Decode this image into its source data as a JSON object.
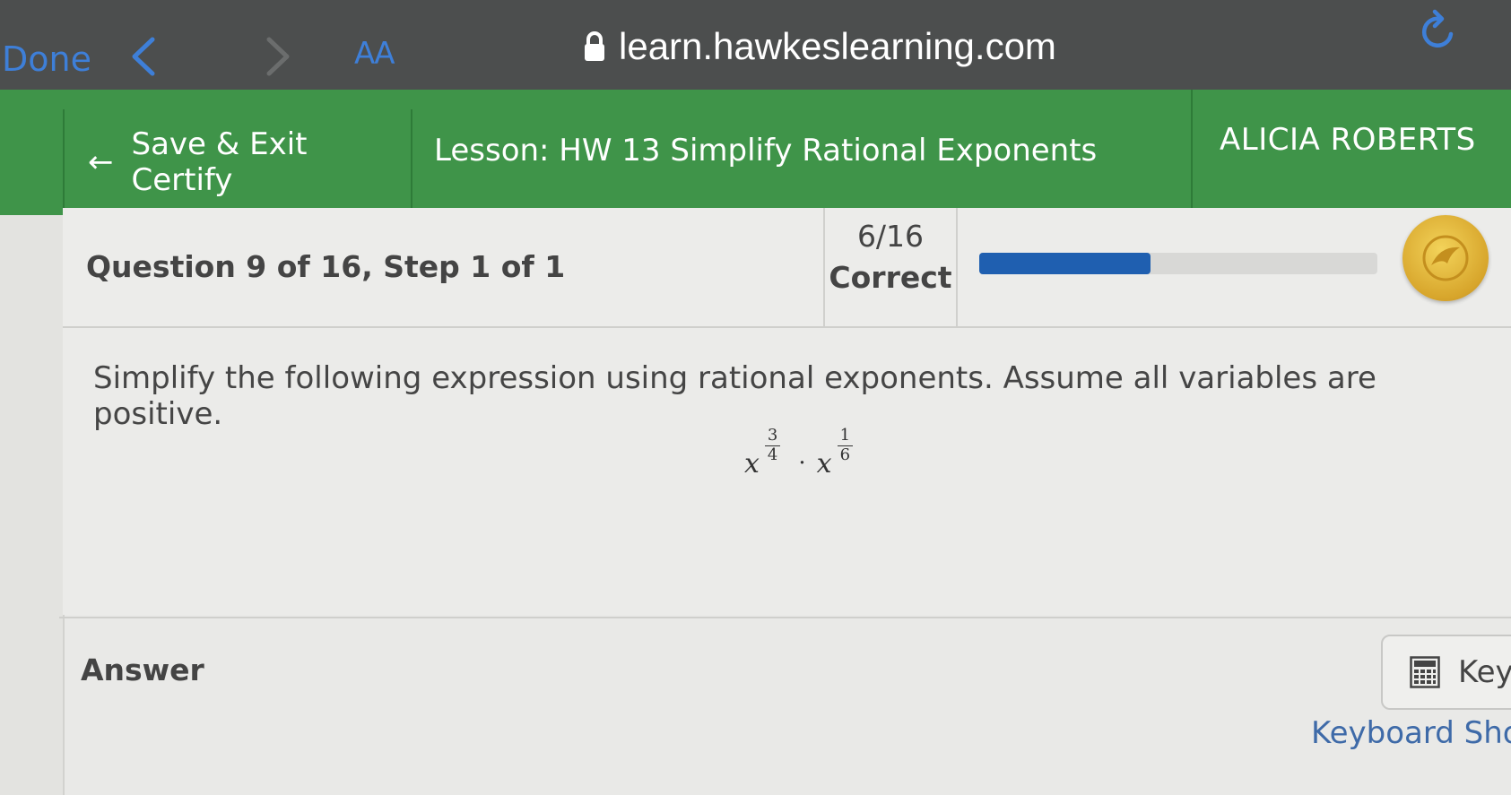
{
  "browser": {
    "done_label": "Done",
    "text_size_label": "AA",
    "url": "learn.hawkeslearning.com",
    "accent_color": "#3e7fd8"
  },
  "header": {
    "save_exit_label": "Save & Exit Certify",
    "lesson_title": "Lesson: HW 13 Simplify Rational Exponents",
    "user_name": "ALICIA ROBERTS",
    "brand_color": "#3f9449"
  },
  "status": {
    "question_label": "Question 9 of 16, Step 1 of 1",
    "score_count": "6/16",
    "score_label": "Correct",
    "progress_fraction": 0.43,
    "progress_color": "#1f5fb0"
  },
  "question": {
    "instruction": "Simplify the following expression using rational exponents. Assume all variables are positive.",
    "expression": {
      "base1": "x",
      "exp1_num": "3",
      "exp1_den": "4",
      "operator": "·",
      "base2": "x",
      "exp2_num": "1",
      "exp2_den": "6"
    }
  },
  "answer": {
    "label": "Answer",
    "keypad_label": "Key",
    "shortcuts_link": "Keyboard Sho"
  }
}
